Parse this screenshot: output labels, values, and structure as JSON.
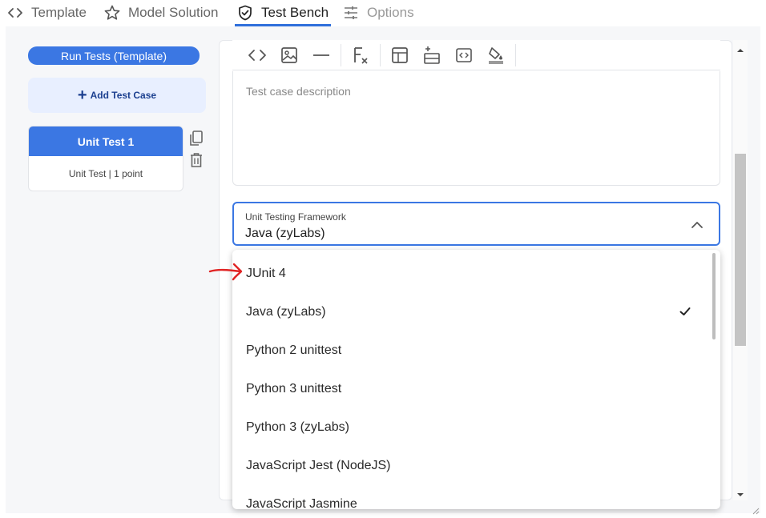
{
  "tabs": [
    {
      "label": "Template",
      "icon": "code-icon"
    },
    {
      "label": "Model Solution",
      "icon": "star-icon"
    },
    {
      "label": "Test Bench",
      "icon": "shield-check-icon"
    },
    {
      "label": "Options",
      "icon": "sliders-icon"
    }
  ],
  "sidebar": {
    "run_label": "Run Tests (Template)",
    "add_label": "Add Test Case",
    "test_case": {
      "title": "Unit Test 1",
      "subtitle": "Unit Test | 1 point"
    }
  },
  "editor": {
    "description_placeholder": "Test case description"
  },
  "framework": {
    "label": "Unit Testing Framework",
    "value": "Java (zyLabs)",
    "options": [
      {
        "label": "JUnit 4",
        "selected": false
      },
      {
        "label": "Java (zyLabs)",
        "selected": true
      },
      {
        "label": "Python 2 unittest",
        "selected": false
      },
      {
        "label": "Python 3 unittest",
        "selected": false
      },
      {
        "label": "Python 3 (zyLabs)",
        "selected": false
      },
      {
        "label": "JavaScript Jest (NodeJS)",
        "selected": false
      },
      {
        "label": "JavaScript Jasmine",
        "selected": false
      }
    ]
  },
  "colors": {
    "accent": "#3b77e3",
    "annotation": "#e02424"
  }
}
